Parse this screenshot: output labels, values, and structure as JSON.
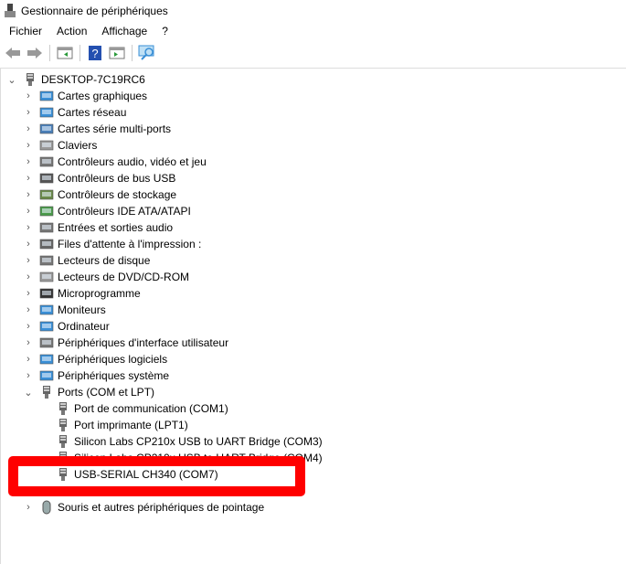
{
  "window": {
    "title": "Gestionnaire de périphériques"
  },
  "menu": [
    "Fichier",
    "Action",
    "Affichage",
    "?"
  ],
  "toolbar": [
    "back-icon",
    "forward-icon",
    "show-hide-console-tree-icon",
    "help-icon",
    "action-pane-icon",
    "scan-hardware-icon"
  ],
  "tree": {
    "root": "DESKTOP-7C19RC6",
    "categories": [
      {
        "label": "Cartes graphiques",
        "icon": "display-adapter-icon",
        "color": "#3a8fd6"
      },
      {
        "label": "Cartes réseau",
        "icon": "network-adapter-icon",
        "color": "#3a8fd6"
      },
      {
        "label": "Cartes série multi-ports",
        "icon": "multiport-serial-icon",
        "color": "#4a7fb8"
      },
      {
        "label": "Claviers",
        "icon": "keyboard-icon",
        "color": "#999999"
      },
      {
        "label": "Contrôleurs audio, vidéo et jeu",
        "icon": "speaker-icon",
        "color": "#777777"
      },
      {
        "label": "Contrôleurs de bus USB",
        "icon": "usb-icon",
        "color": "#555555"
      },
      {
        "label": "Contrôleurs de stockage",
        "icon": "storage-controller-icon",
        "color": "#6a8a4a"
      },
      {
        "label": "Contrôleurs IDE ATA/ATAPI",
        "icon": "ide-controller-icon",
        "color": "#4a9a4a"
      },
      {
        "label": "Entrées et sorties audio",
        "icon": "audio-io-icon",
        "color": "#777777"
      },
      {
        "label": "Files d'attente à l'impression :",
        "icon": "printer-icon",
        "color": "#666666"
      },
      {
        "label": "Lecteurs de disque",
        "icon": "disk-drive-icon",
        "color": "#777777"
      },
      {
        "label": "Lecteurs de DVD/CD-ROM",
        "icon": "dvd-drive-icon",
        "color": "#999999"
      },
      {
        "label": "Microprogramme",
        "icon": "firmware-icon",
        "color": "#333333"
      },
      {
        "label": "Moniteurs",
        "icon": "monitor-icon",
        "color": "#3a8fd6"
      },
      {
        "label": "Ordinateur",
        "icon": "computer-icon",
        "color": "#3a8fd6"
      },
      {
        "label": "Périphériques d'interface utilisateur",
        "icon": "hid-icon",
        "color": "#777777"
      },
      {
        "label": "Périphériques logiciels",
        "icon": "software-device-icon",
        "color": "#3a8fd6"
      },
      {
        "label": "Périphériques système",
        "icon": "system-device-icon",
        "color": "#3a8fd6"
      }
    ],
    "ports": {
      "label": "Ports (COM et LPT)",
      "children": [
        "Port de communication (COM1)",
        "Port imprimante (LPT1)",
        "Silicon Labs CP210x USB to UART Bridge (COM3)",
        "Silicon Labs CP210x USB to UART Bridge (COM4)",
        "USB-SERIAL CH340 (COM7)"
      ]
    },
    "last": "Souris et autres périphériques de pointage"
  },
  "highlight_color": "#ff0000"
}
